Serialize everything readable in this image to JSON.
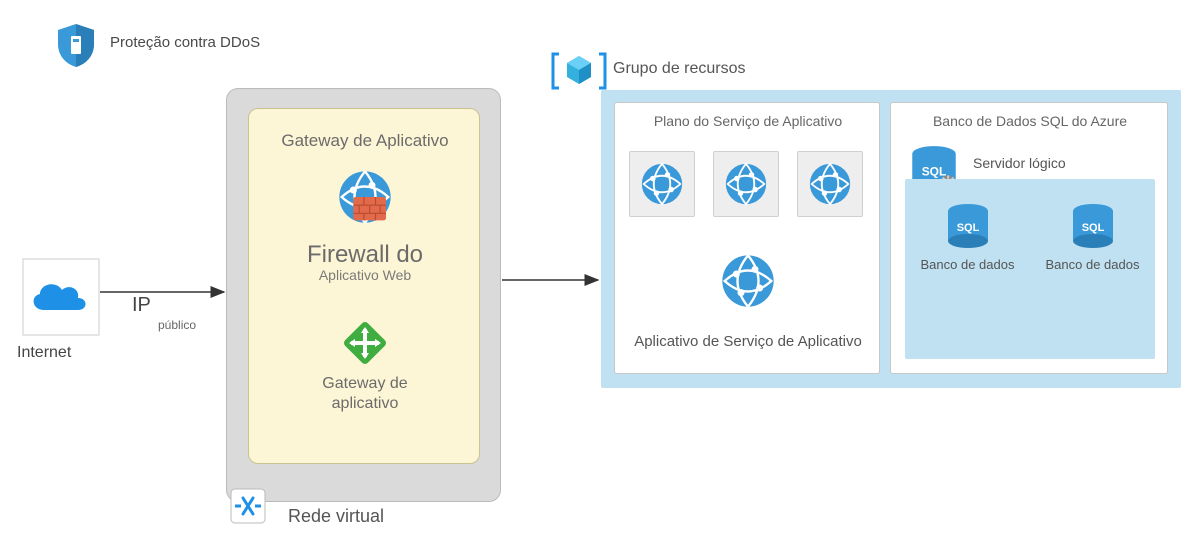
{
  "ddos": {
    "label": "Proteção contra DDoS"
  },
  "internet": {
    "label": "Internet"
  },
  "public_ip": {
    "label": "IP",
    "sublabel": "público"
  },
  "vnet": {
    "label": "Rede virtual",
    "appgw_box": {
      "title": "Gateway de Aplicativo",
      "waf_line1": "Firewall do",
      "waf_line2": "Aplicativo Web",
      "gw_line1": "Gateway de",
      "gw_line2": "aplicativo"
    }
  },
  "resource_group": {
    "label": "Grupo de recursos",
    "app_service_plan": {
      "title": "Plano do Serviço de Aplicativo",
      "app_label": "Aplicativo de Serviço de Aplicativo"
    },
    "sql": {
      "title": "Banco de Dados SQL do Azure",
      "logical_server": "Servidor lógico",
      "db_label_1": "Banco de dados",
      "db_label_2": "Banco de dados"
    }
  },
  "colors": {
    "azure_blue": "#0078d4",
    "light_blue_panel": "#bfe1f2",
    "vnet_grey": "#dadada",
    "appgw_yellow": "#fdf6d6",
    "green": "#3fad3f"
  }
}
